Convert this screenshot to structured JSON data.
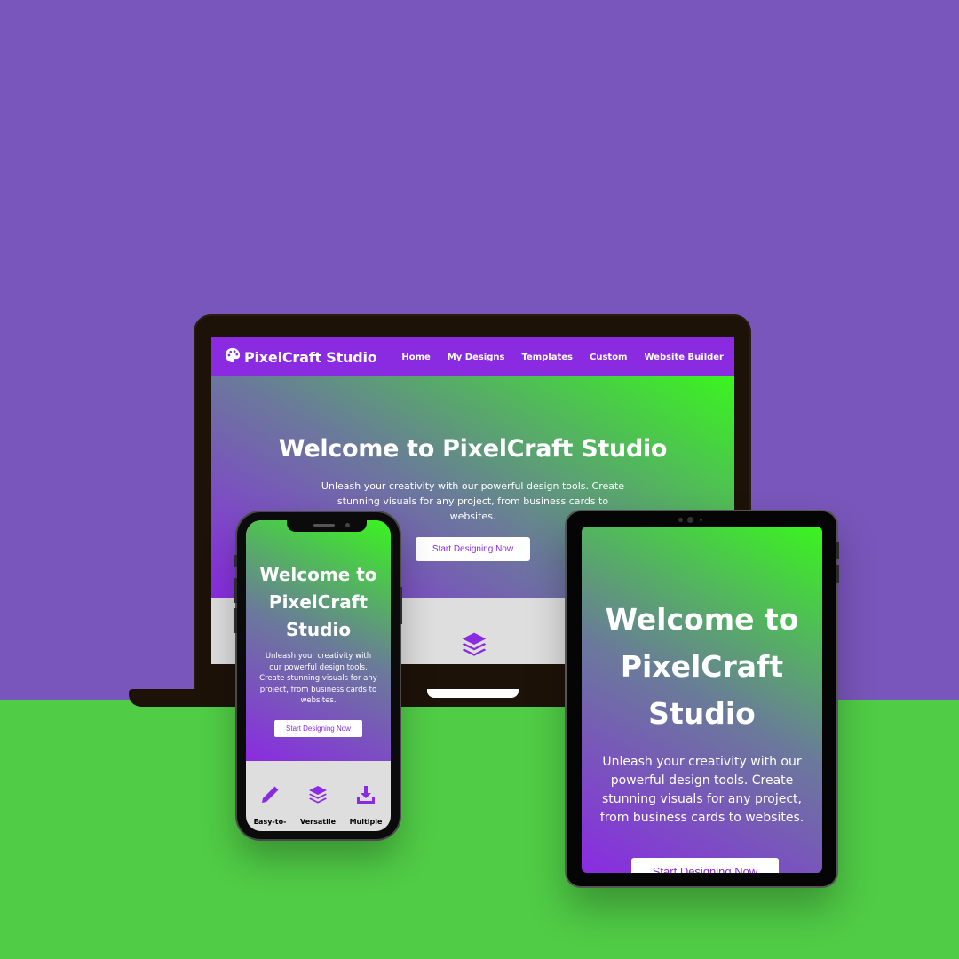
{
  "colors": {
    "background_top": "#7956bb",
    "background_bottom": "#50cc46",
    "brand_purple": "#8a2be2",
    "hero_green": "#3af51e",
    "button_bg": "#ffffff"
  },
  "laptop": {
    "brand": "PixelCraft Studio",
    "logo_icon": "palette-icon",
    "nav": [
      "Home",
      "My Designs",
      "Templates",
      "Custom",
      "Website Builder"
    ],
    "hero_title": "Welcome to PixelCraft Studio",
    "hero_subtitle": "Unleash your creativity with our powerful design tools. Create stunning visuals for any project, from business cards to websites.",
    "cta": "Start Designing Now",
    "feature_icon": "layers-icon"
  },
  "phone": {
    "hero_title": "Welcome to PixelCraft Studio",
    "hero_subtitle": "Unleash your creativity with our powerful design tools. Create stunning visuals for any project, from business cards to websites.",
    "cta": "Start Designing Now",
    "features": [
      {
        "label": "Easy-to-",
        "icon": "pen-icon"
      },
      {
        "label": "Versatile",
        "icon": "layers-icon"
      },
      {
        "label": "Multiple",
        "icon": "download-icon"
      }
    ]
  },
  "tablet": {
    "hero_title": "Welcome to PixelCraft Studio",
    "hero_subtitle": "Unleash your creativity with our powerful design tools. Create stunning visuals for any project, from business cards to websites.",
    "cta": "Start Designing Now"
  }
}
